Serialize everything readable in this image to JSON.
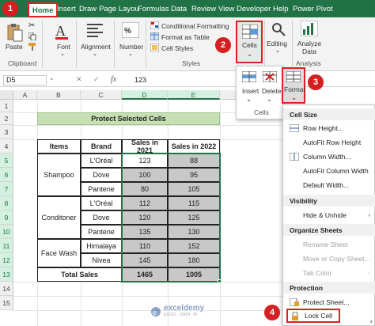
{
  "menubar": {
    "tabs": [
      "Home",
      "Insert",
      "Draw",
      "Page Layou",
      "Formulas",
      "Data",
      "Review",
      "View",
      "Developer",
      "Help",
      "Power Pivot"
    ]
  },
  "ribbon": {
    "paste": "Paste",
    "clipboard": "Clipboard",
    "font": "Font",
    "alignment": "Alignment",
    "number": "Number",
    "conditional_formatting": "Conditional Formatting",
    "format_as_table": "Format as Table",
    "cell_styles": "Cell Styles",
    "styles": "Styles",
    "cells": "Cells",
    "editing": "Editing",
    "analyze_data": "Analyze Data",
    "analysis": "Analysis"
  },
  "cells_dropdown": {
    "insert": "Insert",
    "delete": "Delete",
    "format": "Format",
    "group": "Cells"
  },
  "badges": [
    "1",
    "2",
    "3",
    "4"
  ],
  "formula_bar": {
    "name_box": "D5",
    "fx": "fx",
    "value": "123"
  },
  "grid": {
    "columns": [
      "A",
      "B",
      "C",
      "D",
      "E",
      "F"
    ],
    "rows": [
      "1",
      "2",
      "3",
      "4",
      "5",
      "6",
      "7",
      "8",
      "9",
      "10",
      "11",
      "12",
      "13",
      "14",
      "15"
    ]
  },
  "table": {
    "title": "Protect Selected Cells",
    "headers": [
      "Items",
      "Brand",
      "Sales in 2021",
      "Sales in 2022"
    ],
    "groups": [
      "Shampoo",
      "Conditoner",
      "Face Wash"
    ],
    "brands": [
      "L'Oréal",
      "Dove",
      "Pantene",
      "L'Oréal",
      "Dove",
      "Pantene",
      "Himalaya",
      "Nivea"
    ],
    "sales_2021": [
      "123",
      "100",
      "80",
      "112",
      "120",
      "135",
      "110",
      "145"
    ],
    "sales_2022": [
      "88",
      "95",
      "105",
      "115",
      "125",
      "130",
      "152",
      "180"
    ],
    "total_label": "Total Sales",
    "total_2021": "1465",
    "total_2022": "1005"
  },
  "format_menu": {
    "cell_size": "Cell Size",
    "row_height": "Row Height...",
    "autofit_row_height": "AutoFit Row Height",
    "column_width": "Column Width...",
    "autofit_column_width": "AutoFit Column Width",
    "default_width": "Default Width...",
    "visibility": "Visibility",
    "hide_unhide": "Hide & Unhide",
    "organize_sheets": "Organize Sheets",
    "rename_sheet": "Rename Sheet",
    "move_copy_sheet": "Move or Copy Sheet...",
    "tab_color": "Tab Color",
    "protection": "Protection",
    "protect_sheet": "Protect Sheet...",
    "lock_cell": "Lock Cell"
  },
  "watermark": {
    "name": "exceldemy",
    "tagline": "EXCEL · DATA · BI"
  },
  "colors": {
    "excel_green": "#217346",
    "highlight_red": "#e02020",
    "title_fill": "#c6e0b4",
    "locked_gray": "#c8c8c8"
  }
}
